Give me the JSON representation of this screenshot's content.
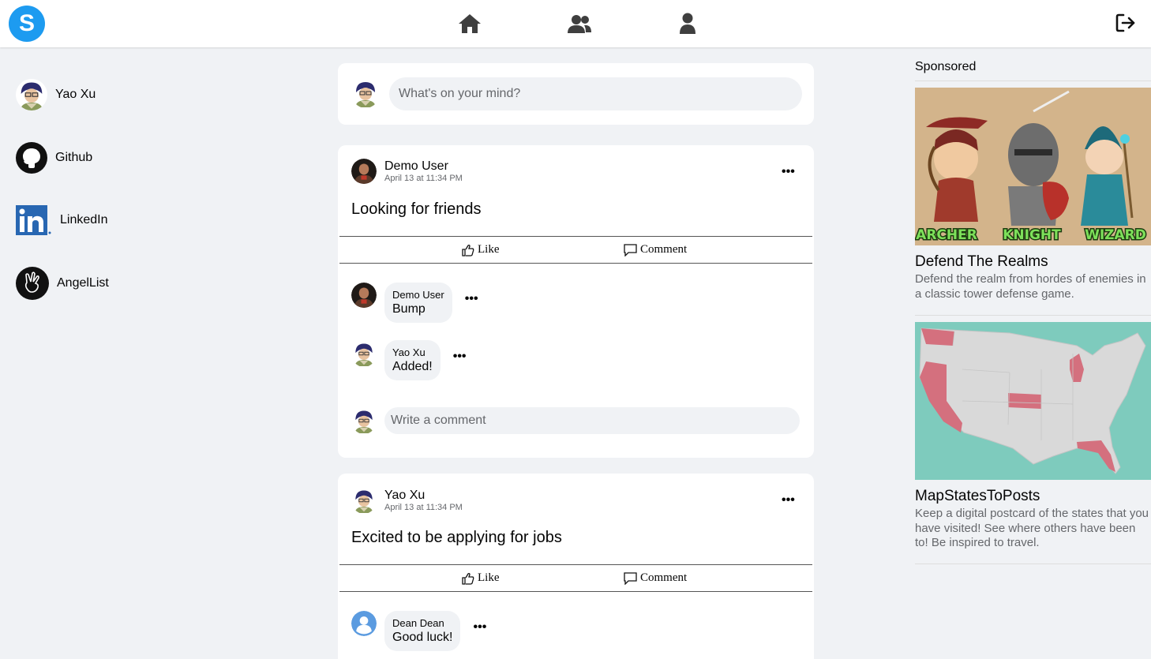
{
  "app": {
    "logo_letter": "S"
  },
  "topnav": {
    "icons": [
      "home-icon",
      "friends-icon",
      "profile-icon"
    ],
    "logout_icon": "logout-icon"
  },
  "sidebar": {
    "items": [
      {
        "label": "Yao Xu",
        "icon": "user-avatar"
      },
      {
        "label": "Github",
        "icon": "github-icon"
      },
      {
        "label": "LinkedIn",
        "icon": "linkedin-icon"
      },
      {
        "label": "AngelList",
        "icon": "angellist-icon"
      }
    ]
  },
  "create_post": {
    "placeholder": "What's on your mind?"
  },
  "posts": [
    {
      "author": "Demo User",
      "time": "April 13 at 11:34 PM",
      "body": "Looking for friends",
      "like_label": "Like",
      "comment_label": "Comment",
      "comments": [
        {
          "author": "Demo User",
          "text": "Bump"
        },
        {
          "author": "Yao Xu",
          "text": "Added!"
        }
      ],
      "write_placeholder": "Write a comment"
    },
    {
      "author": "Yao Xu",
      "time": "April 13 at 11:34 PM",
      "body": "Excited to be applying for jobs",
      "like_label": "Like",
      "comment_label": "Comment",
      "comments": [
        {
          "author": "Dean Dean",
          "text": "Good luck!"
        }
      ]
    }
  ],
  "sponsored": {
    "heading": "Sponsored",
    "ads": [
      {
        "title": "Defend The Realms",
        "description": "Defend the realm from hordes of enemies in a classic tower defense game.",
        "image_labels": [
          "ARCHER",
          "KNIGHT",
          "WIZARD"
        ]
      },
      {
        "title": "MapStatesToPosts",
        "description": "Keep a digital postcard of the states that you have visited! See where others have been to! Be inspired to travel."
      }
    ]
  },
  "colors": {
    "brand": "#1d9bf0",
    "background": "#f0f2f5",
    "muted": "#65676b",
    "map_water": "#7ecbbd",
    "map_land": "#d9d9d9",
    "map_highlight": "#d4707e"
  }
}
